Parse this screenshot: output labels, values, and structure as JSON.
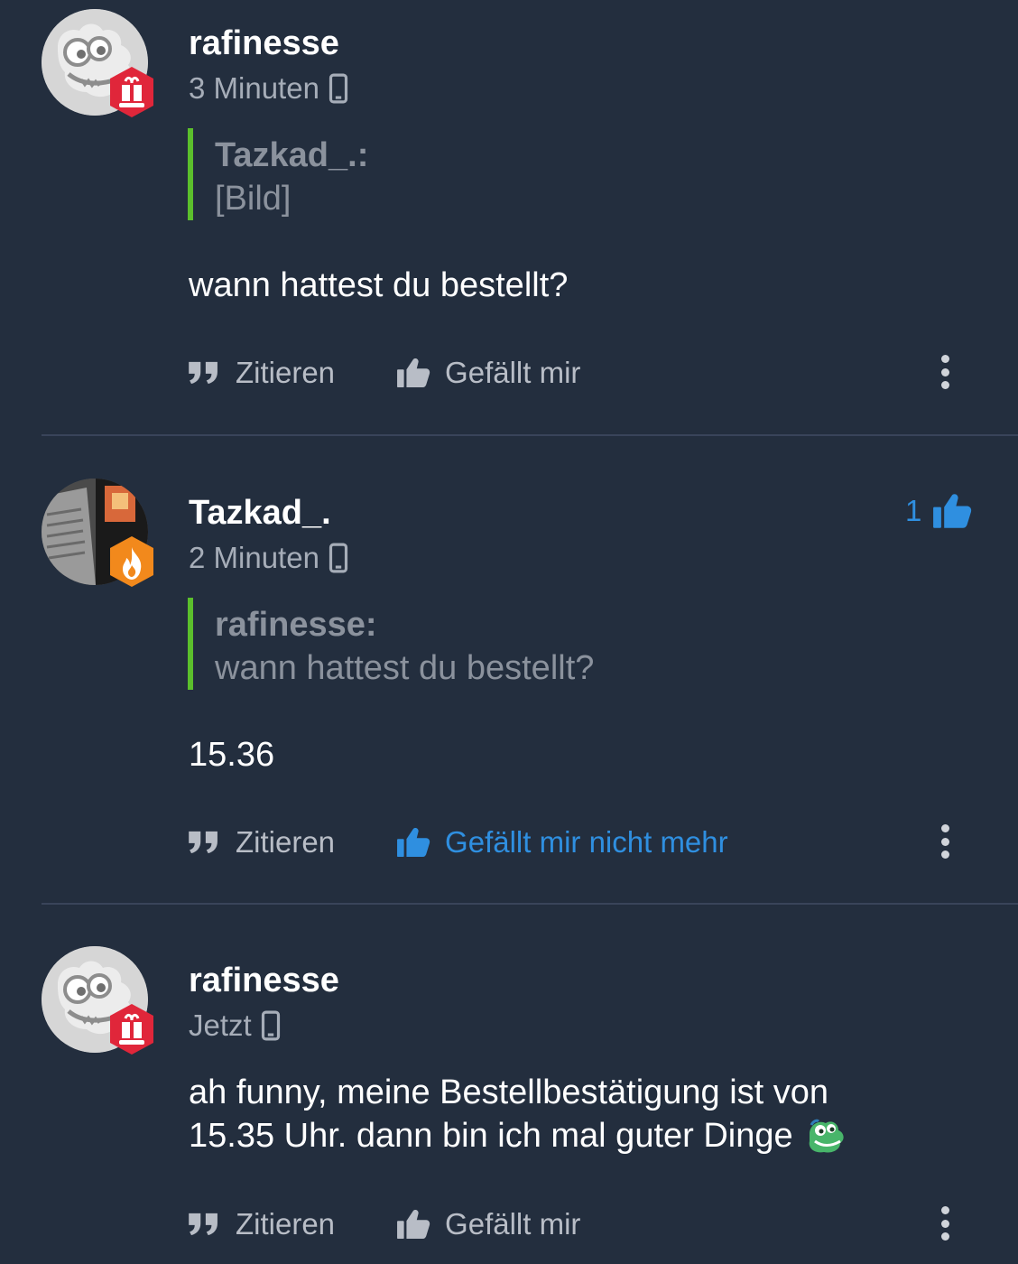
{
  "comments": [
    {
      "username": "rafinesse",
      "time": "3 Minuten",
      "quote": {
        "author": "Tazkad_.:",
        "text": "[Bild]"
      },
      "body": "wann hattest du bestellt?",
      "actions": {
        "quote": "Zitieren",
        "like": "Gefällt mir",
        "liked": false
      },
      "badge": "gift-badge"
    },
    {
      "username": "Tazkad_.",
      "time": "2 Minuten",
      "like_count": "1",
      "quote": {
        "author": "rafinesse:",
        "text": "wann hattest du bestellt?"
      },
      "body": "15.36",
      "actions": {
        "quote": "Zitieren",
        "like": "Gefällt mir nicht mehr",
        "liked": true
      },
      "badge": "fire-badge"
    },
    {
      "username": "rafinesse",
      "time": "Jetzt",
      "body_line1": "ah funny, meine Bestellbestätigung ist von",
      "body_line2": "15.35 Uhr. dann bin ich mal guter Dinge",
      "actions": {
        "quote": "Zitieren",
        "like": "Gefällt mir",
        "liked": false
      },
      "badge": "gift-badge"
    }
  ],
  "colors": {
    "background": "#232e3e",
    "quote_bar": "#5bbf2c",
    "accent_blue": "#2f8fe0",
    "badge_red": "#e0263a",
    "badge_orange": "#f2891c"
  }
}
